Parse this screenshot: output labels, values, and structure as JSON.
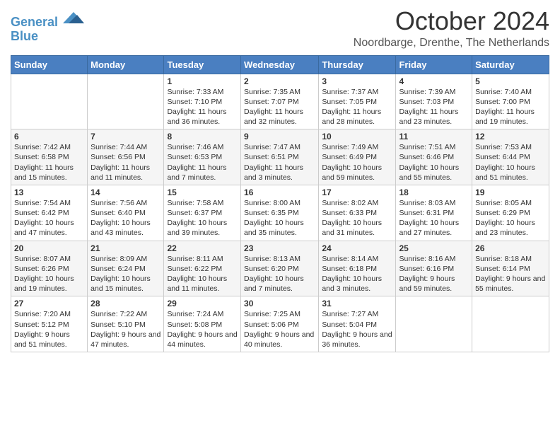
{
  "logo": {
    "line1": "General",
    "line2": "Blue"
  },
  "header": {
    "month": "October 2024",
    "location": "Noordbarge, Drenthe, The Netherlands"
  },
  "weekdays": [
    "Sunday",
    "Monday",
    "Tuesday",
    "Wednesday",
    "Thursday",
    "Friday",
    "Saturday"
  ],
  "weeks": [
    [
      {
        "day": "",
        "content": ""
      },
      {
        "day": "",
        "content": ""
      },
      {
        "day": "1",
        "content": "Sunrise: 7:33 AM\nSunset: 7:10 PM\nDaylight: 11 hours and 36 minutes."
      },
      {
        "day": "2",
        "content": "Sunrise: 7:35 AM\nSunset: 7:07 PM\nDaylight: 11 hours and 32 minutes."
      },
      {
        "day": "3",
        "content": "Sunrise: 7:37 AM\nSunset: 7:05 PM\nDaylight: 11 hours and 28 minutes."
      },
      {
        "day": "4",
        "content": "Sunrise: 7:39 AM\nSunset: 7:03 PM\nDaylight: 11 hours and 23 minutes."
      },
      {
        "day": "5",
        "content": "Sunrise: 7:40 AM\nSunset: 7:00 PM\nDaylight: 11 hours and 19 minutes."
      }
    ],
    [
      {
        "day": "6",
        "content": "Sunrise: 7:42 AM\nSunset: 6:58 PM\nDaylight: 11 hours and 15 minutes."
      },
      {
        "day": "7",
        "content": "Sunrise: 7:44 AM\nSunset: 6:56 PM\nDaylight: 11 hours and 11 minutes."
      },
      {
        "day": "8",
        "content": "Sunrise: 7:46 AM\nSunset: 6:53 PM\nDaylight: 11 hours and 7 minutes."
      },
      {
        "day": "9",
        "content": "Sunrise: 7:47 AM\nSunset: 6:51 PM\nDaylight: 11 hours and 3 minutes."
      },
      {
        "day": "10",
        "content": "Sunrise: 7:49 AM\nSunset: 6:49 PM\nDaylight: 10 hours and 59 minutes."
      },
      {
        "day": "11",
        "content": "Sunrise: 7:51 AM\nSunset: 6:46 PM\nDaylight: 10 hours and 55 minutes."
      },
      {
        "day": "12",
        "content": "Sunrise: 7:53 AM\nSunset: 6:44 PM\nDaylight: 10 hours and 51 minutes."
      }
    ],
    [
      {
        "day": "13",
        "content": "Sunrise: 7:54 AM\nSunset: 6:42 PM\nDaylight: 10 hours and 47 minutes."
      },
      {
        "day": "14",
        "content": "Sunrise: 7:56 AM\nSunset: 6:40 PM\nDaylight: 10 hours and 43 minutes."
      },
      {
        "day": "15",
        "content": "Sunrise: 7:58 AM\nSunset: 6:37 PM\nDaylight: 10 hours and 39 minutes."
      },
      {
        "day": "16",
        "content": "Sunrise: 8:00 AM\nSunset: 6:35 PM\nDaylight: 10 hours and 35 minutes."
      },
      {
        "day": "17",
        "content": "Sunrise: 8:02 AM\nSunset: 6:33 PM\nDaylight: 10 hours and 31 minutes."
      },
      {
        "day": "18",
        "content": "Sunrise: 8:03 AM\nSunset: 6:31 PM\nDaylight: 10 hours and 27 minutes."
      },
      {
        "day": "19",
        "content": "Sunrise: 8:05 AM\nSunset: 6:29 PM\nDaylight: 10 hours and 23 minutes."
      }
    ],
    [
      {
        "day": "20",
        "content": "Sunrise: 8:07 AM\nSunset: 6:26 PM\nDaylight: 10 hours and 19 minutes."
      },
      {
        "day": "21",
        "content": "Sunrise: 8:09 AM\nSunset: 6:24 PM\nDaylight: 10 hours and 15 minutes."
      },
      {
        "day": "22",
        "content": "Sunrise: 8:11 AM\nSunset: 6:22 PM\nDaylight: 10 hours and 11 minutes."
      },
      {
        "day": "23",
        "content": "Sunrise: 8:13 AM\nSunset: 6:20 PM\nDaylight: 10 hours and 7 minutes."
      },
      {
        "day": "24",
        "content": "Sunrise: 8:14 AM\nSunset: 6:18 PM\nDaylight: 10 hours and 3 minutes."
      },
      {
        "day": "25",
        "content": "Sunrise: 8:16 AM\nSunset: 6:16 PM\nDaylight: 9 hours and 59 minutes."
      },
      {
        "day": "26",
        "content": "Sunrise: 8:18 AM\nSunset: 6:14 PM\nDaylight: 9 hours and 55 minutes."
      }
    ],
    [
      {
        "day": "27",
        "content": "Sunrise: 7:20 AM\nSunset: 5:12 PM\nDaylight: 9 hours and 51 minutes."
      },
      {
        "day": "28",
        "content": "Sunrise: 7:22 AM\nSunset: 5:10 PM\nDaylight: 9 hours and 47 minutes."
      },
      {
        "day": "29",
        "content": "Sunrise: 7:24 AM\nSunset: 5:08 PM\nDaylight: 9 hours and 44 minutes."
      },
      {
        "day": "30",
        "content": "Sunrise: 7:25 AM\nSunset: 5:06 PM\nDaylight: 9 hours and 40 minutes."
      },
      {
        "day": "31",
        "content": "Sunrise: 7:27 AM\nSunset: 5:04 PM\nDaylight: 9 hours and 36 minutes."
      },
      {
        "day": "",
        "content": ""
      },
      {
        "day": "",
        "content": ""
      }
    ]
  ]
}
